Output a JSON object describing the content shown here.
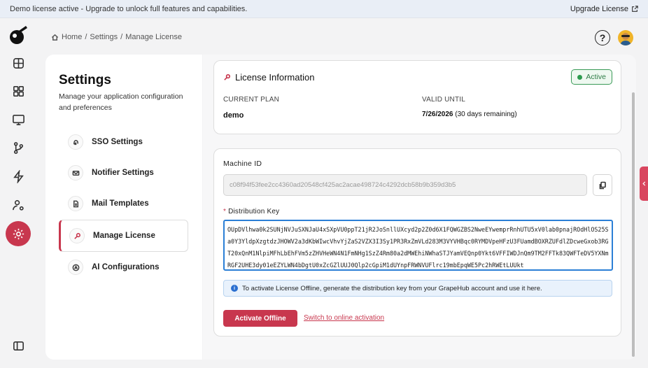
{
  "banner": {
    "message": "Demo license active - Upgrade to unlock full features and capabilities.",
    "upgrade_label": "Upgrade License"
  },
  "rail": {
    "icons": [
      "dashboard-icon",
      "grid-icon",
      "monitor-icon",
      "git-branch-icon",
      "bolt-icon",
      "user-settings-icon",
      "gear-icon",
      "sidebar-toggle-icon"
    ]
  },
  "breadcrumb": {
    "home": "Home",
    "sep": "/",
    "settings": "Settings",
    "current": "Manage License"
  },
  "settings": {
    "title": "Settings",
    "description": "Manage your application configuration and preferences",
    "items": [
      {
        "label": "SSO Settings",
        "icon": "fingerprint-icon"
      },
      {
        "label": "Notifier Settings",
        "icon": "mail-icon"
      },
      {
        "label": "Mail Templates",
        "icon": "file-icon"
      },
      {
        "label": "Manage License",
        "icon": "key-icon",
        "active": true
      },
      {
        "label": "AI Configurations",
        "icon": "ai-icon"
      }
    ]
  },
  "license": {
    "title": "License Information",
    "status": "Active",
    "current_plan_label": "CURRENT PLAN",
    "current_plan": "demo",
    "valid_until_label": "VALID UNTIL",
    "valid_until_date": "7/26/2026",
    "valid_until_remaining": "(30 days remaining)"
  },
  "offline": {
    "machine_id_label": "Machine ID",
    "machine_id": "c08f94f53fee2cc4360ad20548cf425ac2acae498724c4292dcb58b9b359d3b5",
    "distribution_key_label": "Distribution Key",
    "distribution_key": "OUpDVlhwa0k2SUNjNVJuSXNJaU4xSXpVU0ppT21jR2JoSnllUXcyd2p2Z0d6X1FQWGZBS2NweEYwemprRnhUTU5xV0lab0pnajROdHlOS25Sa0Y3YldpXzgtdzJHOWV2a3dKbWIwcVhvYjZaS2VZX3I3Sy1PR3RxZmVLd283M3VYVHBqc0RYMDVpeHFzU3FUamdBOXRZUFdlZDcweGxob3RGT20xQnM1NlpiMFhLbEhFVm5zZHVHeWN4N1FmNHg1SzZ4Rm80a2dMWEhiNWhaSTJYamVEQnp0Ykt6VFFIWDJnQm9TM2FFTk83QWFTeDV5YXNmRGF2UHE3dy01eEZYLWN4bDgtU0xZcGZlUUJ0Qlp2cGpiM1dUYnpFRWNVUFlrc19mbEpqWE5Pc2hRWEtLUUkt",
    "info_text": "To activate License Offline, generate the distribution key from your GrapeHub account and use it here.",
    "activate_label": "Activate Offline",
    "switch_label": "Switch to online activation"
  },
  "colors": {
    "brand": "#c8374e",
    "active_green": "#2e7d46",
    "focus_blue": "#2b7fd6"
  }
}
